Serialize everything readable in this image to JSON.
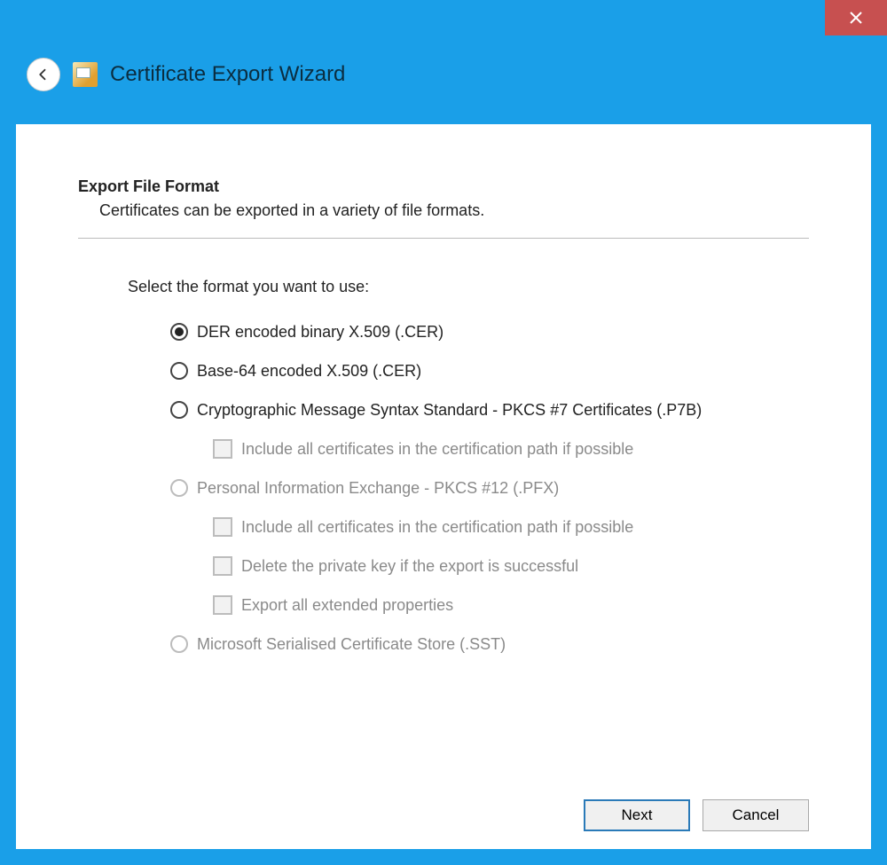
{
  "window": {
    "title": "Certificate Export Wizard"
  },
  "section": {
    "title": "Export File Format",
    "description": "Certificates can be exported in a variety of file formats."
  },
  "prompt": "Select the format you want to use:",
  "options": {
    "der": {
      "label": "DER encoded binary X.509 (.CER)",
      "selected": true,
      "enabled": true
    },
    "base64": {
      "label": "Base-64 encoded X.509 (.CER)",
      "selected": false,
      "enabled": true
    },
    "pkcs7": {
      "label": "Cryptographic Message Syntax Standard - PKCS #7 Certificates (.P7B)",
      "selected": false,
      "enabled": true,
      "sub": {
        "include_path": {
          "label": "Include all certificates in the certification path if possible",
          "checked": false,
          "enabled": false
        }
      }
    },
    "pfx": {
      "label": "Personal Information Exchange - PKCS #12 (.PFX)",
      "selected": false,
      "enabled": false,
      "sub": {
        "include_path": {
          "label": "Include all certificates in the certification path if possible",
          "checked": false,
          "enabled": false
        },
        "delete_key": {
          "label": "Delete the private key if the export is successful",
          "checked": false,
          "enabled": false
        },
        "export_ext": {
          "label": "Export all extended properties",
          "checked": false,
          "enabled": false
        }
      }
    },
    "sst": {
      "label": "Microsoft Serialised Certificate Store (.SST)",
      "selected": false,
      "enabled": false
    }
  },
  "buttons": {
    "next": "Next",
    "cancel": "Cancel"
  }
}
